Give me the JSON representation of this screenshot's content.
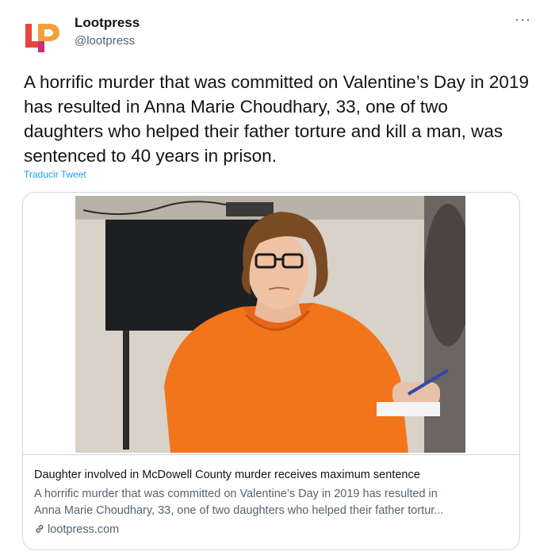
{
  "account": {
    "name": "Lootpress",
    "handle": "@lootpress",
    "brand_colors": [
      "#e8453a",
      "#f2a13a",
      "#c1307a"
    ]
  },
  "tweet": {
    "text": "A horrific murder that was committed on Valentine’s Day in 2019 has resulted in Anna Marie Choudhary, 33, one of two daughters who helped their father torture and kill a man, was sentenced to 40 years in prison.",
    "translate_label": "Traducir Tweet",
    "more_label": "···"
  },
  "card": {
    "title": "Daughter involved in McDowell County murder receives maximum sentence",
    "description_line1": "A horrific murder that was committed on Valentine’s Day in 2019 has resulted in",
    "description_line2": "Anna Marie Choudhary, 33, one of two daughters who helped their father tortur...",
    "domain": "lootpress.com",
    "image_subject": "woman in orange jumpsuit seated in courtroom"
  },
  "icons": {
    "more": "more-icon",
    "link": "link-icon"
  }
}
